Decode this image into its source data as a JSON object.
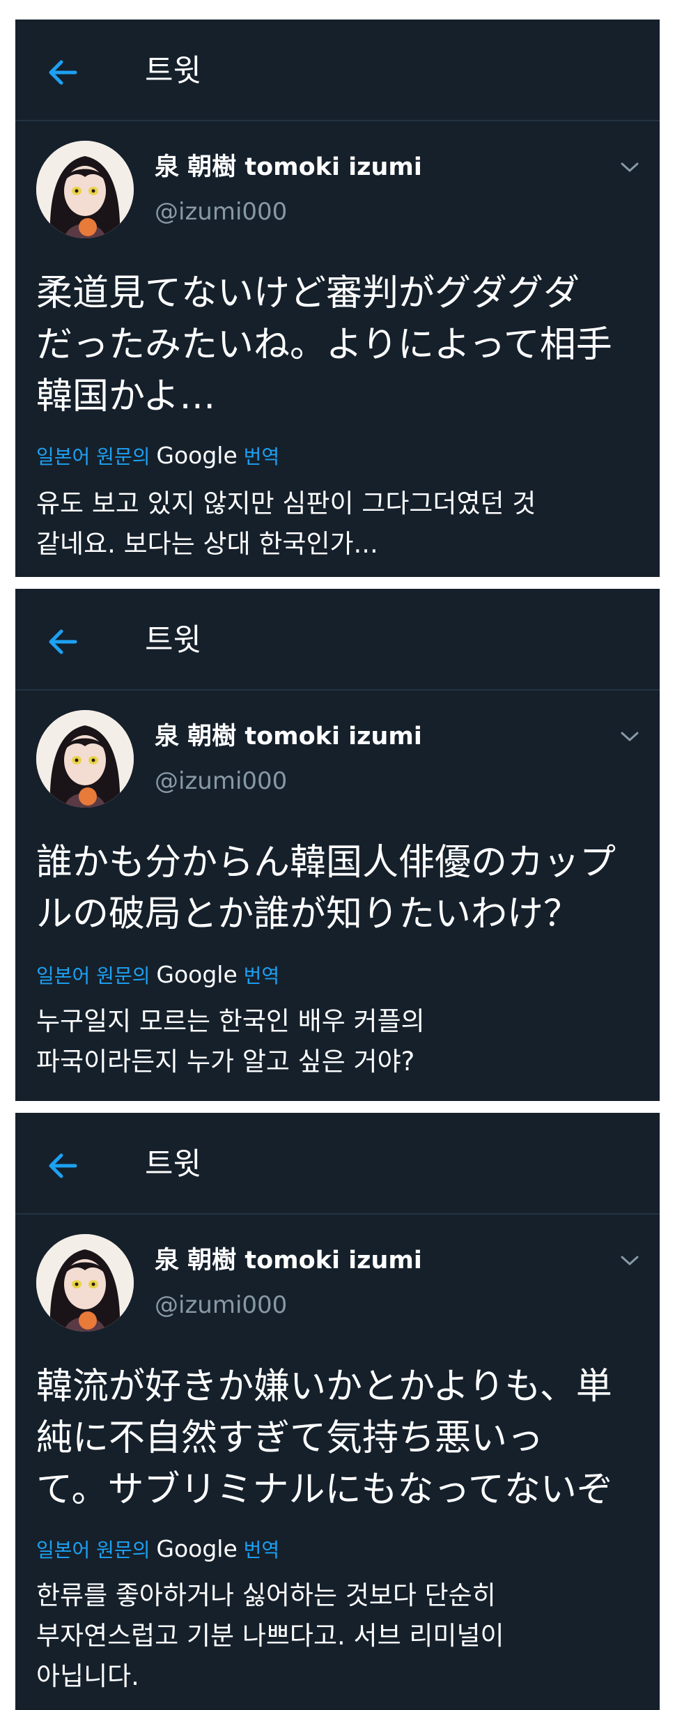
{
  "colors": {
    "background": "#15202b",
    "accent": "#1da1f2",
    "secondary_text": "#8899a6",
    "divider": "#253341"
  },
  "screen_title": "트윗",
  "back_icon": "arrow-left-icon",
  "menu_icon": "chevron-down-icon",
  "tweets": [
    {
      "name": "泉 朝樹 tomoki izumi",
      "handle": "@izumi000",
      "text_lines": [
        "柔道見てないけど審判がグダグダ",
        "だったみたいね。よりによって相手",
        "韓国かよ…"
      ],
      "translate_prefix": "일본어 원문의",
      "translate_provider": "Google",
      "translate_suffix": "번역",
      "translation_lines": [
        "유도 보고 있지 않지만 심판이 그다그더였던 것",
        "같네요. 보다는 상대 한국인가..."
      ]
    },
    {
      "name": "泉 朝樹 tomoki izumi",
      "handle": "@izumi000",
      "text_lines": [
        "誰かも分からん韓国人俳優のカップ",
        "ルの破局とか誰が知りたいわけ？"
      ],
      "translate_prefix": "일본어 원문의",
      "translate_provider": "Google",
      "translate_suffix": "번역",
      "translation_lines": [
        "누구일지 모르는 한국인 배우 커플의",
        "파국이라든지 누가 알고 싶은 거야?"
      ]
    },
    {
      "name": "泉 朝樹 tomoki izumi",
      "handle": "@izumi000",
      "text_lines": [
        "韓流が好きか嫌いかとかよりも、単",
        "純に不自然すぎて気持ち悪いっ",
        "て。サブリミナルにもなってないぞ"
      ],
      "translate_prefix": "일본어 원문의",
      "translate_provider": "Google",
      "translate_suffix": "번역",
      "translation_lines": [
        "한류를 좋아하거나 싫어하는 것보다 단순히",
        "부자연스럽고 기분 나쁘다고. 서브 리미널이",
        "아닙니다."
      ]
    }
  ]
}
